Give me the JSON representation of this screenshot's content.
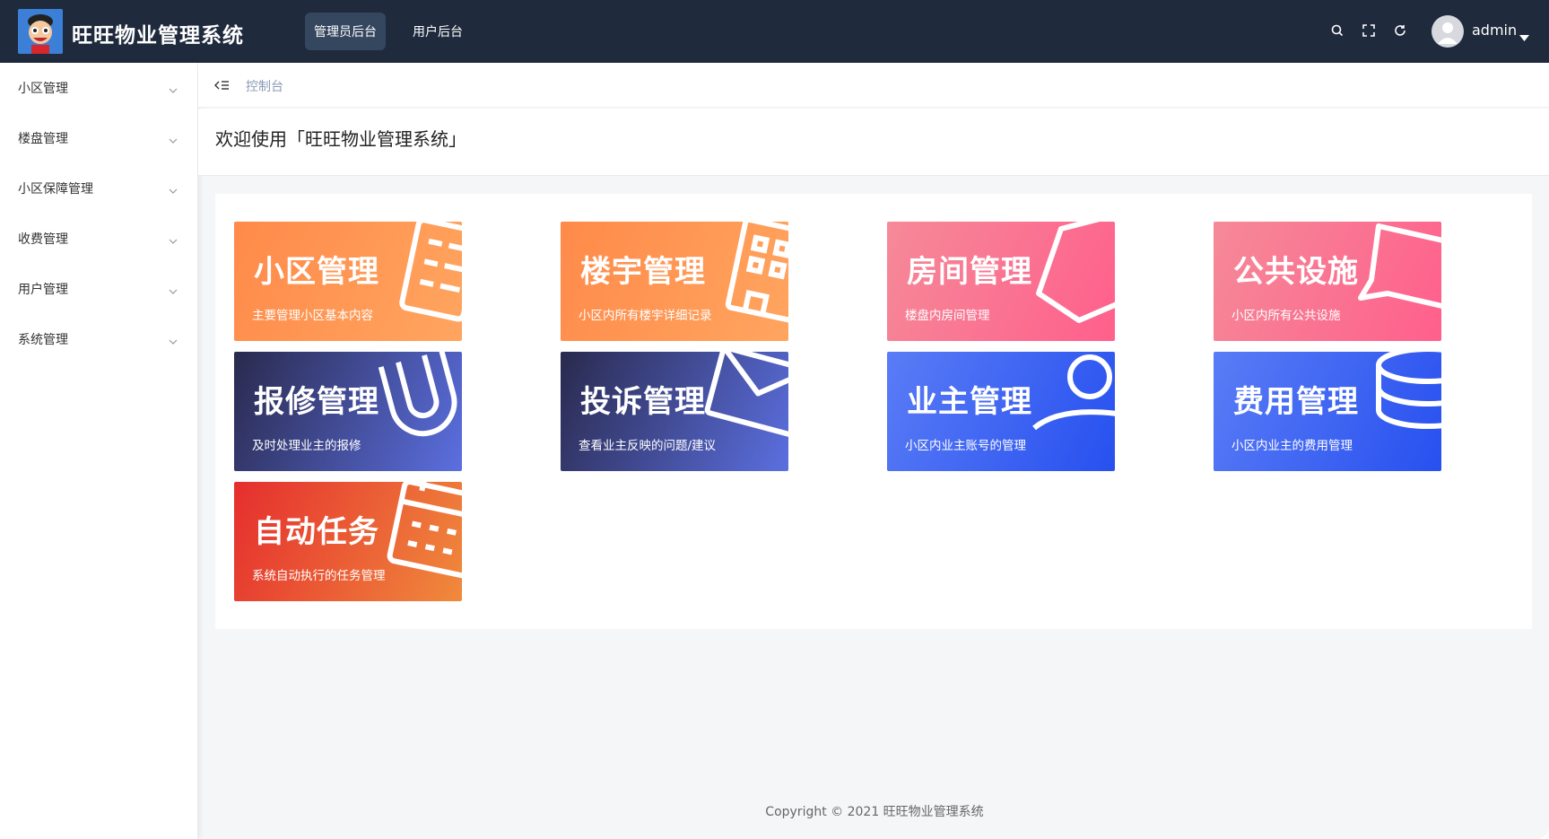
{
  "app": {
    "title": "旺旺物业管理系统"
  },
  "header": {
    "nav": [
      {
        "label": "管理员后台",
        "active": true
      },
      {
        "label": "用户后台",
        "active": false
      }
    ],
    "tools": [
      "search-icon",
      "fullscreen-icon",
      "refresh-icon"
    ],
    "user": {
      "name": "admin"
    }
  },
  "sidebar": {
    "items": [
      {
        "label": "小区管理"
      },
      {
        "label": "楼盘管理"
      },
      {
        "label": "小区保障管理"
      },
      {
        "label": "收费管理"
      },
      {
        "label": "用户管理"
      },
      {
        "label": "系统管理"
      }
    ]
  },
  "breadcrumb": {
    "current": "控制台"
  },
  "welcome": "欢迎使用「旺旺物业管理系统」",
  "cards": [
    {
      "title": "小区管理",
      "desc": "主要管理小区基本内容",
      "theme": "orange",
      "icon": "list-icon"
    },
    {
      "title": "楼宇管理",
      "desc": "小区内所有楼宇详细记录",
      "theme": "orange",
      "icon": "building-icon"
    },
    {
      "title": "房间管理",
      "desc": "楼盘内房间管理",
      "theme": "pink",
      "icon": "home-icon"
    },
    {
      "title": "公共设施",
      "desc": "小区内所有公共设施",
      "theme": "pink",
      "icon": "chat-bubble-icon"
    },
    {
      "title": "报修管理",
      "desc": "及时处理业主的报修",
      "theme": "navy",
      "icon": "magnet-icon"
    },
    {
      "title": "投诉管理",
      "desc": "查看业主反映的问题/建议",
      "theme": "navy",
      "icon": "envelope-icon"
    },
    {
      "title": "业主管理",
      "desc": "小区内业主账号的管理",
      "theme": "blue",
      "icon": "user-icon"
    },
    {
      "title": "费用管理",
      "desc": "小区内业主的费用管理",
      "theme": "blue",
      "icon": "coins-icon"
    },
    {
      "title": "自动任务",
      "desc": "系统自动执行的任务管理",
      "theme": "red",
      "icon": "calendar-icon"
    }
  ],
  "footer": "Copyright © 2021 旺旺物业管理系统"
}
